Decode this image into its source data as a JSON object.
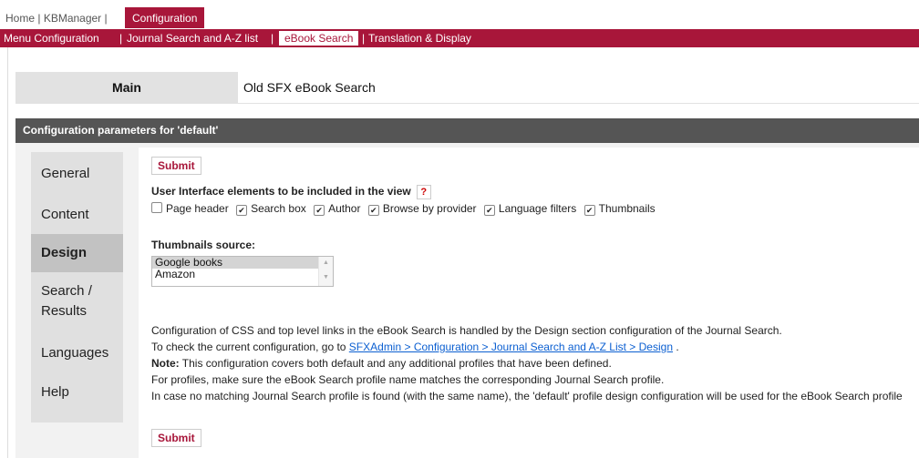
{
  "top_nav": {
    "home": "Home",
    "kbmanager": "KBManager",
    "configuration": "Configuration"
  },
  "sub_nav": {
    "menu_configuration": "Menu Configuration",
    "journal_search": "Journal Search and A-Z list",
    "ebook_search": "eBook Search",
    "translation": "Translation & Display"
  },
  "tabs": {
    "main": "Main",
    "old": "Old SFX eBook Search"
  },
  "params_title": "Configuration parameters for 'default'",
  "sidebar": {
    "items": [
      {
        "label": "General"
      },
      {
        "label": "Content"
      },
      {
        "label": "Design"
      },
      {
        "label": "Search /"
      },
      {
        "label": "Results"
      },
      {
        "label": "Languages"
      },
      {
        "label": "Help"
      }
    ],
    "active": "Design"
  },
  "form": {
    "submit_label": "Submit",
    "ui_elements_label": "User Interface elements to be included in the view",
    "help_label": "?",
    "checkboxes": [
      {
        "label": "Page header",
        "checked": false
      },
      {
        "label": "Search box",
        "checked": true
      },
      {
        "label": "Author",
        "checked": true
      },
      {
        "label": "Browse by provider",
        "checked": true
      },
      {
        "label": "Language filters",
        "checked": true
      },
      {
        "label": "Thumbnails",
        "checked": true
      }
    ],
    "thumbnails_label": "Thumbnails source:",
    "thumbnail_options": [
      "Google books",
      "Amazon"
    ],
    "thumbnail_selected": "Google books"
  },
  "info": {
    "line1": "Configuration of CSS and top level links in the eBook Search is handled by the Design section configuration of the Journal Search.",
    "line2_prefix": "To check the current configuration, go to ",
    "line2_link": "SFXAdmin > Configuration > Journal Search and A-Z List > Design",
    "line2_suffix": " .",
    "line3_bold": "Note:",
    "line3_text": " This configuration covers both default and any additional profiles that have been defined.",
    "line4": "For profiles, make sure the eBook Search profile name matches the corresponding Journal Search profile.",
    "line5": "In case no matching Journal Search profile is found (with the same name), the 'default' profile design configuration will be used for the eBook Search profile"
  },
  "colors": {
    "brand": "#a8163a",
    "dark_bar": "#555555",
    "link": "#0b5fd1"
  }
}
